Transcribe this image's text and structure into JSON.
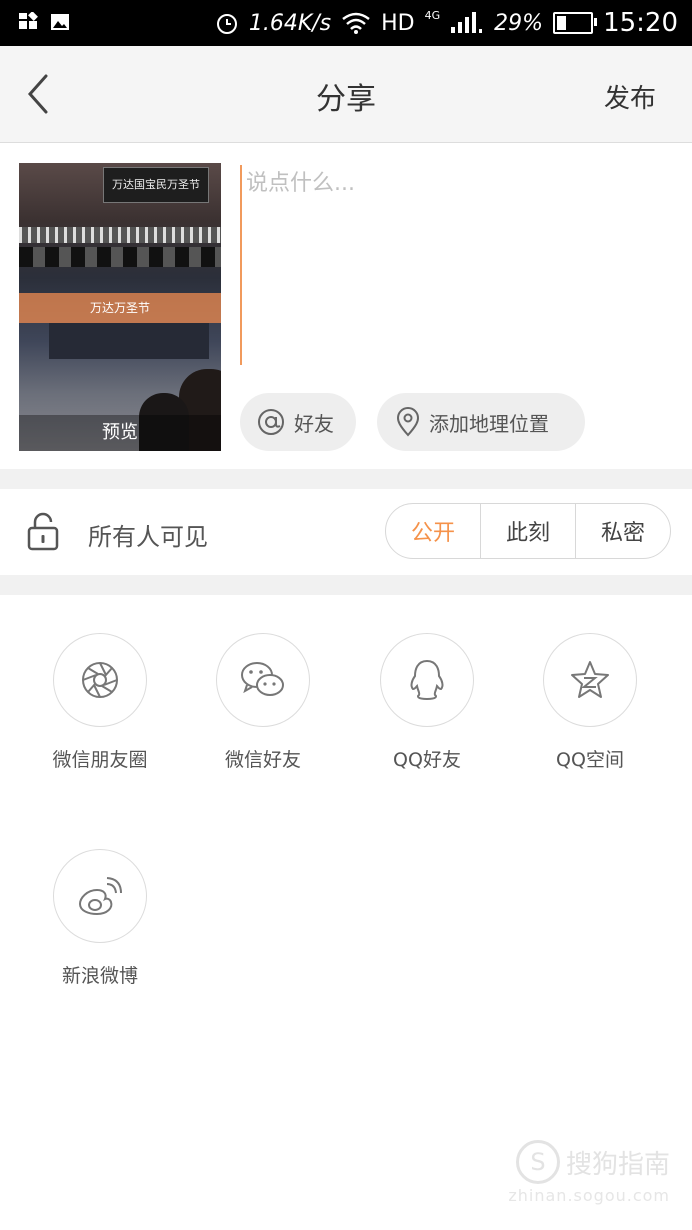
{
  "status_bar": {
    "speed": "1.64K/s",
    "network": "HD",
    "network_gen": "4G",
    "battery": "29%",
    "battery_level": 0.29,
    "time": "15:20"
  },
  "header": {
    "back_icon": "chevron-left-icon",
    "title": "分享",
    "publish_label": "发布"
  },
  "compose": {
    "placeholder": "说点什么...",
    "thumbnail": {
      "sign_text": "万达国宝民万圣节",
      "banner_text": "万达万圣节",
      "preview_label": "预览"
    },
    "mention_label": "好友",
    "location_label": "添加地理位置"
  },
  "visibility": {
    "label": "所有人可见",
    "options": [
      "公开",
      "此刻",
      "私密"
    ],
    "selected": "公开",
    "accent_color": "#f5924a"
  },
  "share": {
    "targets": [
      {
        "label": "微信朋友圈",
        "icon": "wechat-moments-icon"
      },
      {
        "label": "微信好友",
        "icon": "wechat-icon"
      },
      {
        "label": "QQ好友",
        "icon": "qq-icon"
      },
      {
        "label": "QQ空间",
        "icon": "qzone-icon"
      },
      {
        "label": "新浪微博",
        "icon": "weibo-icon"
      }
    ]
  },
  "watermark": {
    "brand": "搜狗指南",
    "url": "zhinan.sogou.com"
  }
}
